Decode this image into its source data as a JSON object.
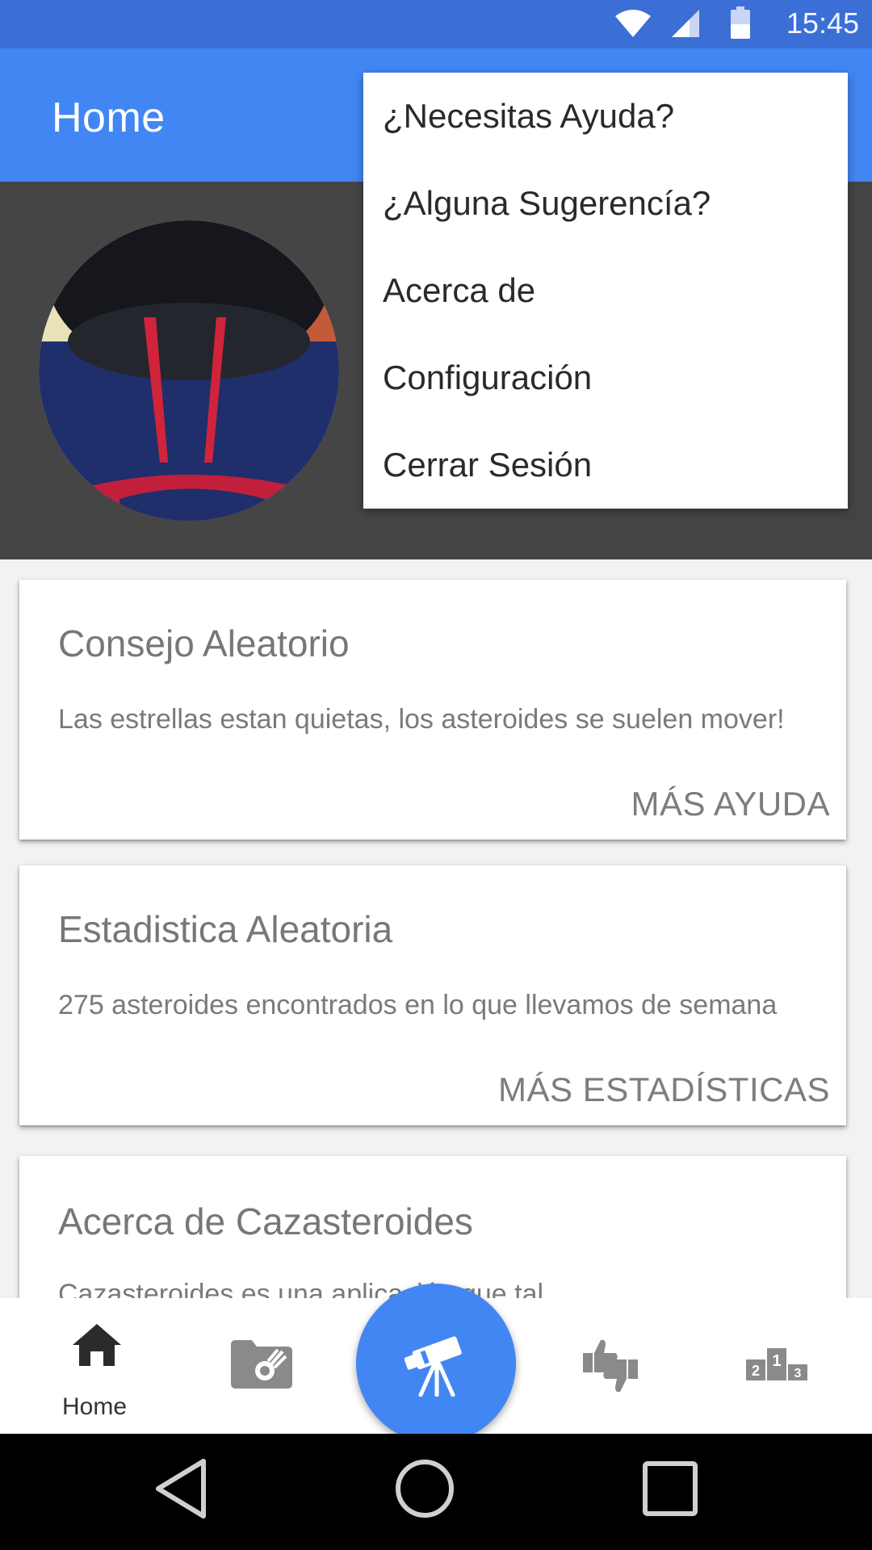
{
  "status_bar": {
    "time": "15:45",
    "icons": [
      "wifi-icon",
      "signal-icon",
      "battery-icon"
    ]
  },
  "app_bar": {
    "title": "Home"
  },
  "overflow_menu": {
    "items": [
      {
        "label": "¿Necesitas Ayuda?"
      },
      {
        "label": "¿Alguna Sugerencía?"
      },
      {
        "label": "Acerca de"
      },
      {
        "label": "Configuración"
      },
      {
        "label": "Cerrar Sesión"
      }
    ]
  },
  "cards": [
    {
      "title": "Consejo Aleatorio",
      "body": "Las estrellas estan quietas, los asteroides se suelen mover!",
      "action": "MÁS AYUDA"
    },
    {
      "title": "Estadistica Aleatoria",
      "body": "275 asteroides encontrados en lo que llevamos de semana",
      "action": "MÁS ESTADÍSTICAS"
    },
    {
      "title": "Acerca de Cazasteroides",
      "body": "Cazasteroides es una aplicación que tal"
    }
  ],
  "bottom_nav": {
    "home_label": "Home",
    "items": [
      "home-icon",
      "asteroid-folder-icon",
      "telescope-icon",
      "vote-icon",
      "podium-icon"
    ],
    "podium_numbers": [
      "2",
      "1",
      "3"
    ]
  },
  "colors": {
    "primary": "#4286f4",
    "status_bar": "#3b6fd6",
    "profile_bg": "#454545",
    "page_bg": "#f2f2f2"
  }
}
